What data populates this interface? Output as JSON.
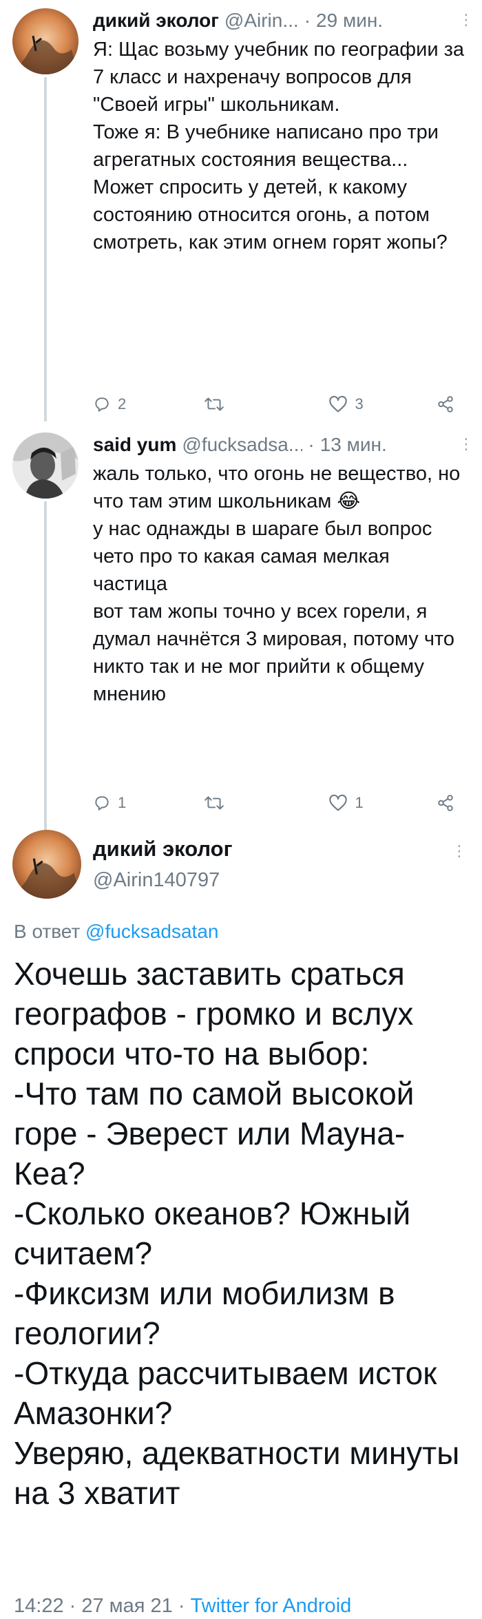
{
  "tweets": [
    {
      "author_name": "дикий эколог",
      "handle": "@Airin...",
      "time": "29 мин.",
      "text": [
        "Я: Щас возьму учебник по географии за 7 класс и нахреначу вопросов для \"Своей игры\" школьникам.",
        "Тоже я: В учебнике написано про три агрегатных состояния вещества... Может спросить у детей, к какому состоянию относится огонь, а потом смотреть, как этим огнем горят жопы?"
      ],
      "replies": "2",
      "retweets": "",
      "likes": "3"
    },
    {
      "author_name": "said yum",
      "handle": "@fucksadsa...",
      "time": "13 мин.",
      "text": [
        "жаль только, что огонь не вещество, но что там этим школьникам 😂",
        "у нас однажды в шараге был вопрос чето про то какая самая мелкая частица",
        "вот там жопы точно у всех горели, я думал начнётся 3 мировая, потому что никто так и не мог прийти к общему мнению"
      ],
      "replies": "1",
      "retweets": "",
      "likes": "1"
    }
  ],
  "main_tweet": {
    "author_name": "дикий эколог",
    "handle": "@Airin140797",
    "reply_prefix": "В ответ",
    "reply_to": "@fucksadsatan",
    "text": [
      "Хочешь заставить сраться географов - громко и вслух спроси что-то на выбор:",
      "-Что там по самой высокой горе - Эверест или Мауна-Кеа?",
      "-Сколько океанов? Южный считаем?",
      "-Фиксизм или мобилизм в геологии?",
      "-Откуда рассчитываем исток Амазонки?",
      "Уверяю, адекватности минуты на 3 хватит"
    ],
    "time": "14:22",
    "date": "27 мая 21",
    "source": "Twitter for Android"
  },
  "icons": {
    "reply": "reply-icon",
    "retweet": "retweet-icon",
    "like": "heart-icon",
    "share": "share-icon",
    "more": "more-vertical-icon"
  },
  "colors": {
    "link": "#1d9bf0",
    "secondary": "#6e7b86",
    "thread_line": "#cfd9de"
  }
}
